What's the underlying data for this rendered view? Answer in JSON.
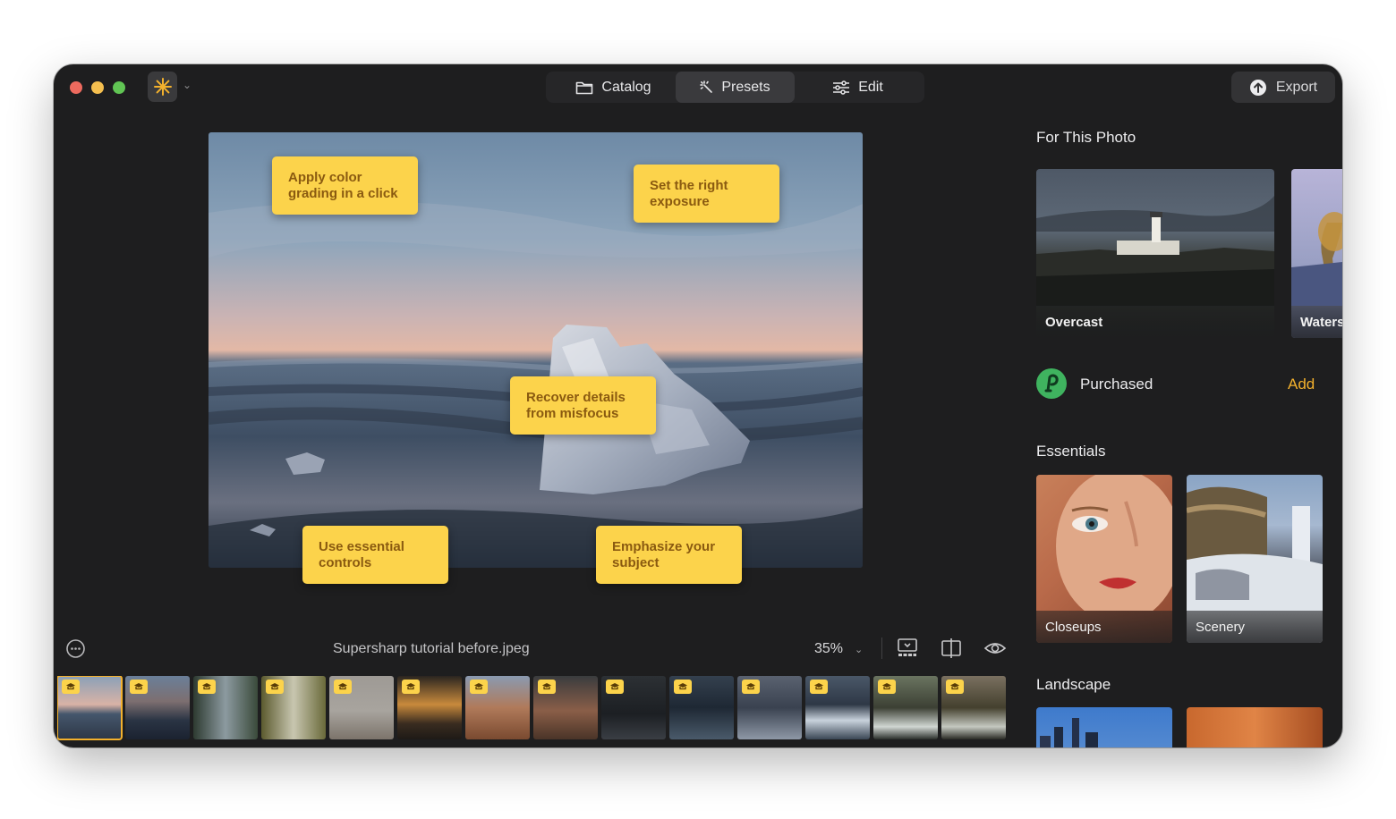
{
  "toolbar": {
    "tabs": [
      {
        "label": "Catalog",
        "icon": "folder-icon"
      },
      {
        "label": "Presets",
        "icon": "sparkle-icon",
        "active": true
      },
      {
        "label": "Edit",
        "icon": "sliders-icon"
      }
    ],
    "export_label": "Export"
  },
  "canvas": {
    "notes": [
      "Apply color grading in a click",
      "Set the right exposure",
      "Recover details from misfocus",
      "Use essential controls",
      "Emphasize your subject"
    ]
  },
  "bottom_bar": {
    "filename": "Supersharp tutorial before.jpeg",
    "zoom": "35%"
  },
  "filmstrip": {
    "count": 14,
    "selected_index": 0
  },
  "sidebar": {
    "for_this_photo_title": "For This Photo",
    "for_this_photo": [
      {
        "label": "Overcast"
      },
      {
        "label": "Waters"
      }
    ],
    "purchased_label": "Purchased",
    "add_label": "Add",
    "essentials_title": "Essentials",
    "essentials": [
      {
        "label": "Closeups"
      },
      {
        "label": "Scenery"
      }
    ],
    "landscape_title": "Landscape"
  },
  "colors": {
    "accent": "#f3b12d",
    "note_bg": "#fcd34b",
    "note_text": "#8a5a10",
    "window_bg": "#1e1e1f"
  }
}
